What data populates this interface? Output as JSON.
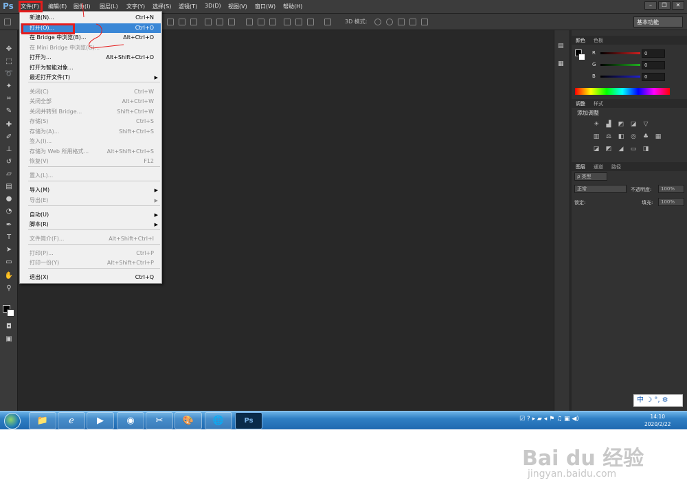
{
  "app": {
    "logo": "Ps"
  },
  "menubar": {
    "items": [
      "文件(F)",
      "编辑(E)",
      "图像(I)",
      "图层(L)",
      "文字(Y)",
      "选择(S)",
      "滤镜(T)",
      "3D(D)",
      "视图(V)",
      "窗口(W)",
      "帮助(H)"
    ],
    "window_buttons": [
      "–",
      "❐",
      "✕"
    ]
  },
  "options_bar": {
    "mode_3d_label": "3D 模式:",
    "workspace": "基本功能"
  },
  "file_menu": {
    "items": [
      {
        "label": "新建(N)...",
        "shortcut": "Ctrl+N",
        "state": "enabled"
      },
      {
        "label": "打开(O)...",
        "shortcut": "Ctrl+O",
        "state": "highlighted"
      },
      {
        "label": "在 Bridge 中浏览(B)...",
        "shortcut": "Alt+Ctrl+O",
        "state": "enabled"
      },
      {
        "label": "在 Mini Bridge 中浏览(G)...",
        "shortcut": "",
        "state": "disabled"
      },
      {
        "label": "打开为...",
        "shortcut": "Alt+Shift+Ctrl+O",
        "state": "enabled"
      },
      {
        "label": "打开为智能对象...",
        "shortcut": "",
        "state": "enabled"
      },
      {
        "label": "最近打开文件(T)",
        "shortcut": "",
        "state": "submenu"
      },
      {
        "label": "关闭(C)",
        "shortcut": "Ctrl+W",
        "state": "disabled"
      },
      {
        "label": "关闭全部",
        "shortcut": "Alt+Ctrl+W",
        "state": "disabled"
      },
      {
        "label": "关闭并转到 Bridge...",
        "shortcut": "Shift+Ctrl+W",
        "state": "disabled"
      },
      {
        "label": "存储(S)",
        "shortcut": "Ctrl+S",
        "state": "disabled"
      },
      {
        "label": "存储为(A)...",
        "shortcut": "Shift+Ctrl+S",
        "state": "disabled"
      },
      {
        "label": "签入(I)...",
        "shortcut": "",
        "state": "disabled"
      },
      {
        "label": "存储为 Web 所用格式...",
        "shortcut": "Alt+Shift+Ctrl+S",
        "state": "disabled"
      },
      {
        "label": "恢复(V)",
        "shortcut": "F12",
        "state": "disabled"
      },
      {
        "label": "置入(L)...",
        "shortcut": "",
        "state": "disabled"
      },
      {
        "label": "导入(M)",
        "shortcut": "",
        "state": "submenu"
      },
      {
        "label": "导出(E)",
        "shortcut": "",
        "state": "submenu-disabled"
      },
      {
        "label": "自动(U)",
        "shortcut": "",
        "state": "submenu"
      },
      {
        "label": "脚本(R)",
        "shortcut": "",
        "state": "submenu"
      },
      {
        "label": "文件简介(F)...",
        "shortcut": "Alt+Shift+Ctrl+I",
        "state": "disabled"
      },
      {
        "label": "打印(P)...",
        "shortcut": "Ctrl+P",
        "state": "disabled"
      },
      {
        "label": "打印一份(Y)",
        "shortcut": "Alt+Shift+Ctrl+P",
        "state": "disabled"
      },
      {
        "label": "退出(X)",
        "shortcut": "Ctrl+Q",
        "state": "enabled"
      }
    ]
  },
  "color_panel": {
    "tabs": [
      "颜色",
      "色板"
    ],
    "channels": [
      {
        "label": "R",
        "value": "0",
        "color": "#d02020"
      },
      {
        "label": "G",
        "value": "0",
        "color": "#20b020"
      },
      {
        "label": "B",
        "value": "0",
        "color": "#2020d0"
      }
    ]
  },
  "adjustments_panel": {
    "tabs": [
      "调整",
      "样式"
    ],
    "title": "添加调整"
  },
  "layers_panel": {
    "tabs": [
      "图层",
      "通道",
      "路径"
    ],
    "filter_label": "ρ 类型",
    "blend_mode": "正常",
    "opacity_label": "不透明度:",
    "opacity_value": "100%",
    "lock_label": "锁定:",
    "fill_label": "填充:",
    "fill_value": "100%"
  },
  "ime": {
    "text": "中 ☽ °, ⚙"
  },
  "taskbar": {
    "apps": [
      "folder-icon",
      "ie-icon",
      "media-icon",
      "chrome-icon",
      "tool-icon",
      "paint-icon",
      "globe-icon",
      "photoshop-icon"
    ],
    "ps_label": "Ps",
    "clock_time": "14:10",
    "clock_date": "2020/2/22"
  },
  "watermark": {
    "text": "Bai du 经验",
    "url": "jingyan.baidu.com"
  }
}
